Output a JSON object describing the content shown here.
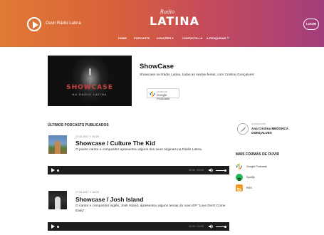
{
  "header": {
    "listen_label": "Ouvir Rádio Latina",
    "logo_script": "Radio",
    "logo_main": "LATINA",
    "login_label": "LOGIN",
    "nav": [
      "HOME",
      "PODCASTS",
      "DOAÇÕES ▾",
      "CONTACTA-LA",
      "A PESQUISAR 🔍"
    ]
  },
  "featured": {
    "image_word": "SHOWCASE",
    "image_sub": "NA RADIO LATINA",
    "title": "ShowCase",
    "description": "Showcase na Rádio Latina, todas as sextas-feiras, com Cristina Gonçalves!",
    "badge_small": "LISTEN ON",
    "badge_name": "Google Podcasts"
  },
  "episodes_section": {
    "title": "ÚLTIMOS PODCASTS PUBLICADOS",
    "episodes": [
      {
        "date": "27.04.2017 // 20:29",
        "title": "Showcase / Culture The Kid",
        "description": "O jovem cantor e compositor apresentou alguns dos seus originais na Rádio Latina.",
        "time": "00:00 / 00:00"
      },
      {
        "date": "27.04.2017 // 18:29",
        "title": "Showcase / Josh Island",
        "description": "O cantor e compositor inglês, Josh Island, apresentou alguns temas do novo EP \"Love Don't Come Easy\".",
        "time": "00:00 / 00:00"
      }
    ]
  },
  "sidebar": {
    "host_label": "HOSTED POR",
    "host_name": "Ana Cristina MEDONCA GONÇALVES",
    "more_title": "MAIS FORMAS DE OUVIR",
    "listen_options": [
      {
        "icon": "google-podcasts-icon",
        "label": "Google Podcasts"
      },
      {
        "icon": "spotify-icon",
        "label": "Spotify"
      },
      {
        "icon": "rss-icon",
        "label": "RSS"
      }
    ]
  },
  "colors": {
    "header_start": "#e07a35",
    "header_end": "#a23e7c",
    "player_bg": "#1d1d1d",
    "spotify": "#1db954",
    "rss": "#f39a1e"
  }
}
